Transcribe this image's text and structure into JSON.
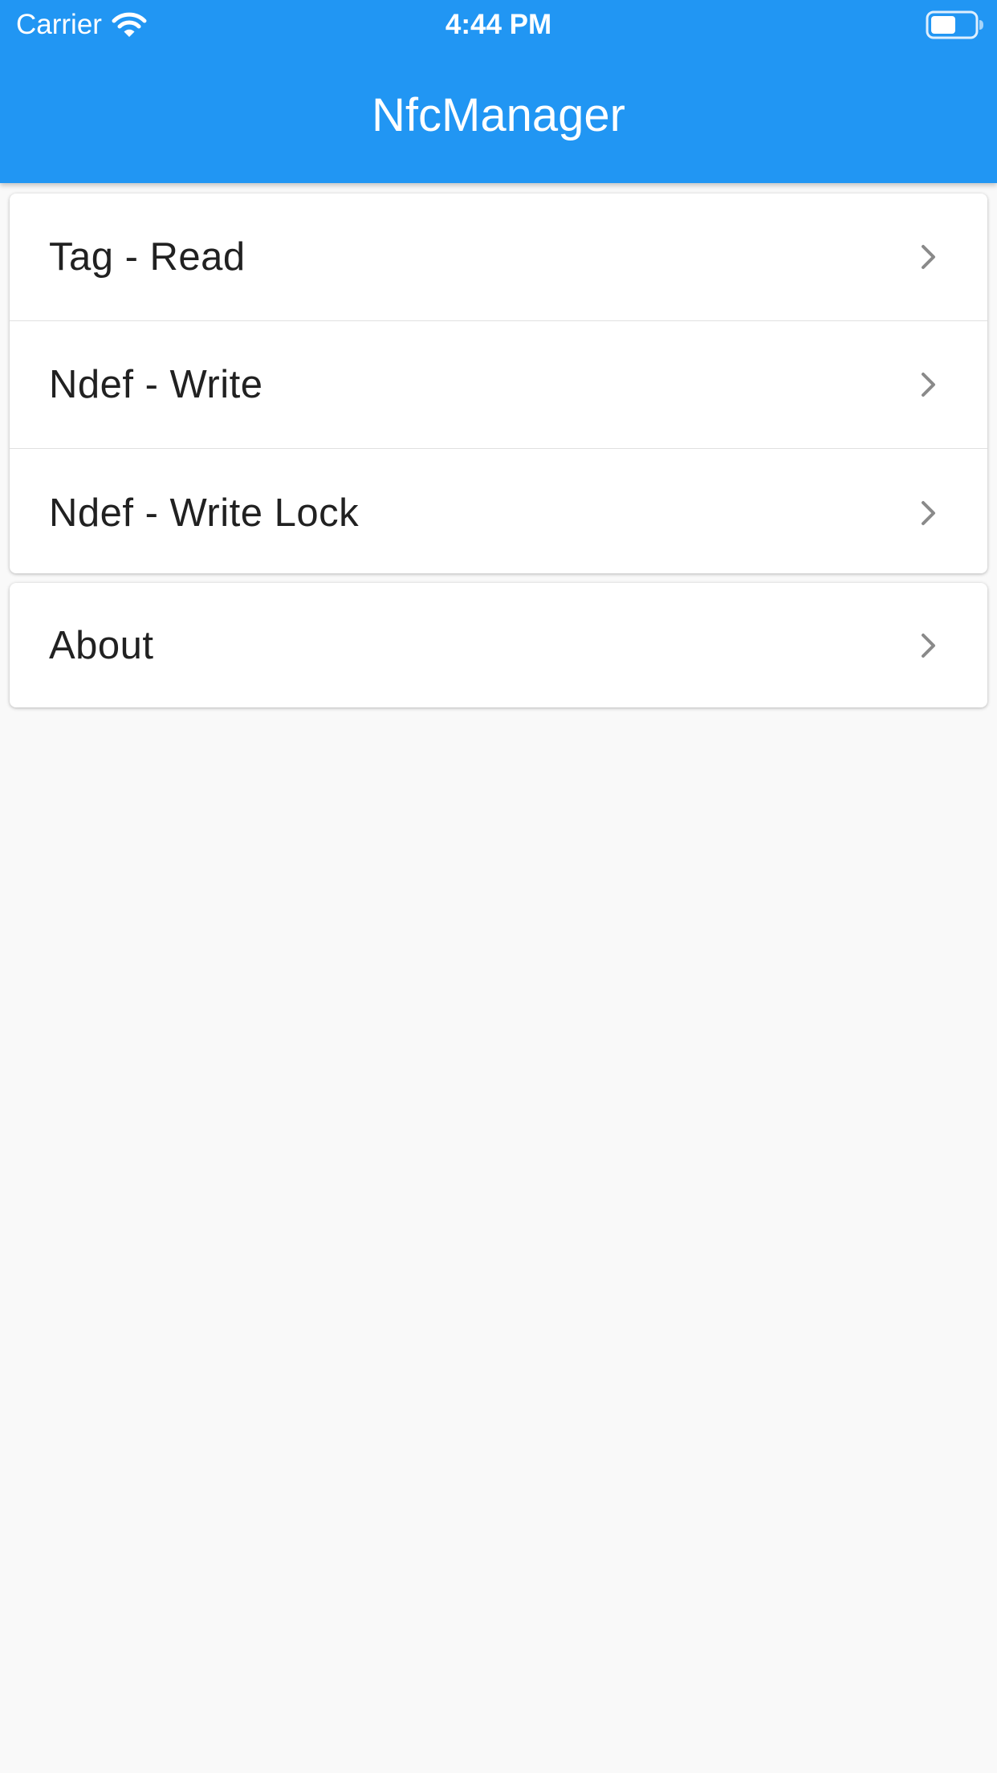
{
  "status_bar": {
    "carrier": "Carrier",
    "time": "4:44 PM",
    "wifi_icon": "wifi-icon",
    "battery_icon": "battery-icon"
  },
  "app_bar": {
    "title": "NfcManager",
    "color": "#2196f3"
  },
  "menu": {
    "items": [
      {
        "label": "Tag - Read",
        "icon": "chevron-right-icon"
      },
      {
        "label": "Ndef - Write",
        "icon": "chevron-right-icon"
      },
      {
        "label": "Ndef - Write Lock",
        "icon": "chevron-right-icon"
      }
    ],
    "about": {
      "label": "About",
      "icon": "chevron-right-icon"
    }
  },
  "colors": {
    "background": "#f9f9f9",
    "card": "#ffffff",
    "text": "#212121",
    "chevron": "#8a8a8a"
  }
}
